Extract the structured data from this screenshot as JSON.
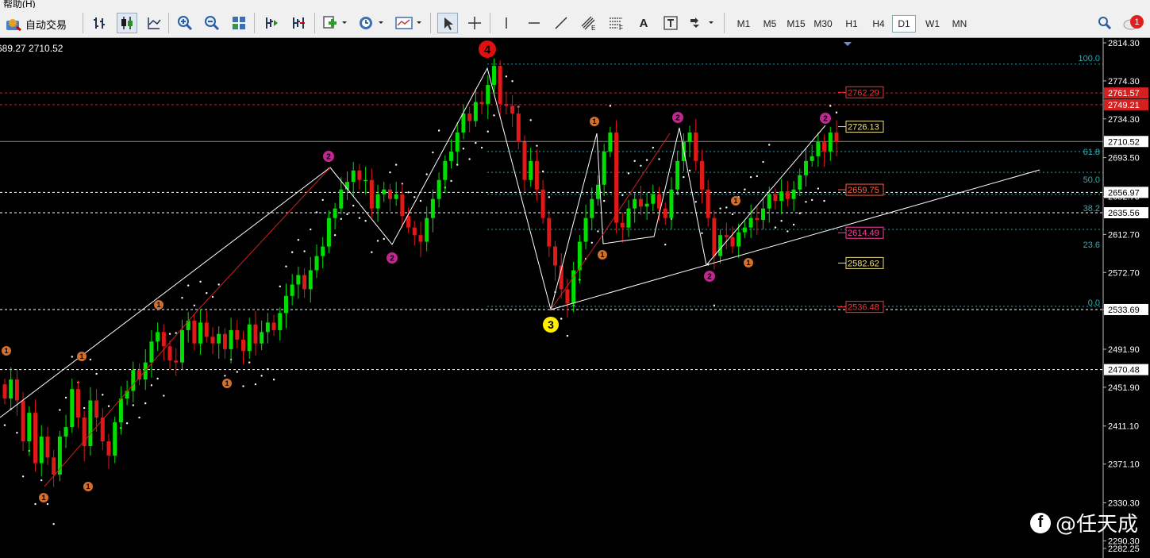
{
  "menu": {
    "partial_label": "帮助(H)"
  },
  "toolbar": {
    "auto_trade_label": "自动交易",
    "text_tool_label": "A",
    "timeframes": [
      "M1",
      "M5",
      "M15",
      "M30",
      "H1",
      "H4",
      "D1",
      "W1",
      "MN"
    ],
    "active_timeframe": "D1",
    "notification_count": "1"
  },
  "chart_info": {
    "ohlc_text": "689.27 2710.52"
  },
  "axis": {
    "ticks": [
      "2814.30",
      "2774.30",
      "2734.30",
      "2693.50",
      "2652.70",
      "2612.70",
      "2572.70",
      "2533.69",
      "2491.90",
      "2451.90",
      "2411.10",
      "2371.10",
      "2330.30",
      "2290.30",
      "2282.25"
    ],
    "price_tags": [
      {
        "text": "2761.57",
        "color": "#d62020"
      },
      {
        "text": "2749.21",
        "color": "#d62020"
      },
      {
        "text": "2710.52",
        "color": "#ffffff"
      },
      {
        "text": "2656.97",
        "color": "#ffffff"
      },
      {
        "text": "2635.56",
        "color": "#ffffff"
      },
      {
        "text": "2533.69",
        "color": "#ffffff"
      },
      {
        "text": "2470.48",
        "color": "#ffffff"
      }
    ]
  },
  "fib_levels": [
    "100.0",
    "61.8",
    "50.0",
    "38.2",
    "23.6",
    "0.0"
  ],
  "boxed_prices": [
    {
      "text": "2762.29",
      "color": "#ff3030"
    },
    {
      "text": "2726.13",
      "color": "#f0e080"
    },
    {
      "text": "2659.75",
      "color": "#ff6040"
    },
    {
      "text": "2614.49",
      "color": "#ff40a0"
    },
    {
      "text": "2582.62",
      "color": "#f0e080"
    },
    {
      "text": "2536.48",
      "color": "#ff3030"
    }
  ],
  "wave_labels": [
    {
      "text": "4",
      "kind": "big-red"
    },
    {
      "text": "3",
      "kind": "big-yellow"
    },
    {
      "text": "2",
      "kind": "magenta"
    },
    {
      "text": "2",
      "kind": "magenta"
    },
    {
      "text": "2",
      "kind": "magenta"
    },
    {
      "text": "2",
      "kind": "magenta"
    },
    {
      "text": "2",
      "kind": "magenta"
    },
    {
      "text": "1",
      "kind": "orange"
    },
    {
      "text": "1",
      "kind": "orange"
    },
    {
      "text": "1",
      "kind": "orange"
    },
    {
      "text": "1",
      "kind": "orange"
    },
    {
      "text": "1",
      "kind": "orange"
    },
    {
      "text": "1",
      "kind": "orange"
    },
    {
      "text": "1",
      "kind": "orange"
    },
    {
      "text": "1",
      "kind": "orange"
    },
    {
      "text": "1",
      "kind": "orange"
    },
    {
      "text": "1",
      "kind": "orange"
    }
  ],
  "watermark": {
    "icon": "facebook-icon",
    "text": "@任天成"
  },
  "colors": {
    "bull": "#00e000",
    "bear": "#e01818",
    "background": "#000000"
  },
  "chart_data": {
    "type": "candlestick",
    "y_range": [
      2282.25,
      2814.3
    ],
    "closes": [
      2440,
      2460,
      2438,
      2395,
      2425,
      2372,
      2400,
      2378,
      2360,
      2400,
      2410,
      2450,
      2420,
      2390,
      2438,
      2420,
      2395,
      2380,
      2415,
      2440,
      2448,
      2470,
      2460,
      2478,
      2500,
      2510,
      2495,
      2480,
      2478,
      2512,
      2522,
      2498,
      2520,
      2505,
      2498,
      2508,
      2492,
      2512,
      2502,
      2490,
      2518,
      2498,
      2510,
      2520,
      2512,
      2530,
      2548,
      2560,
      2570,
      2555,
      2575,
      2590,
      2600,
      2630,
      2640,
      2660,
      2668,
      2680,
      2670,
      2670,
      2640,
      2655,
      2660,
      2650,
      2655,
      2632,
      2620,
      2612,
      2605,
      2630,
      2650,
      2670,
      2690,
      2700,
      2720,
      2740,
      2732,
      2752,
      2750,
      2770,
      2790,
      2750,
      2748,
      2740,
      2710,
      2670,
      2690,
      2660,
      2630,
      2600,
      2580,
      2555,
      2540,
      2575,
      2605,
      2630,
      2650,
      2665,
      2700,
      2720,
      2625,
      2620,
      2640,
      2650,
      2642,
      2645,
      2655,
      2640,
      2630,
      2660,
      2690,
      2710,
      2720,
      2690,
      2660,
      2630,
      2590,
      2612,
      2610,
      2600,
      2615,
      2620,
      2630,
      2628,
      2640,
      2655,
      2648,
      2658,
      2650,
      2660,
      2675,
      2690,
      2695,
      2710,
      2700,
      2720,
      2710
    ],
    "levels": {
      "resistance": [
        2762.29,
        2761.57,
        2749.21
      ],
      "targets": [
        2726.13,
        2659.75,
        2614.49,
        2582.62,
        2536.48
      ],
      "last": 2710.52
    }
  }
}
